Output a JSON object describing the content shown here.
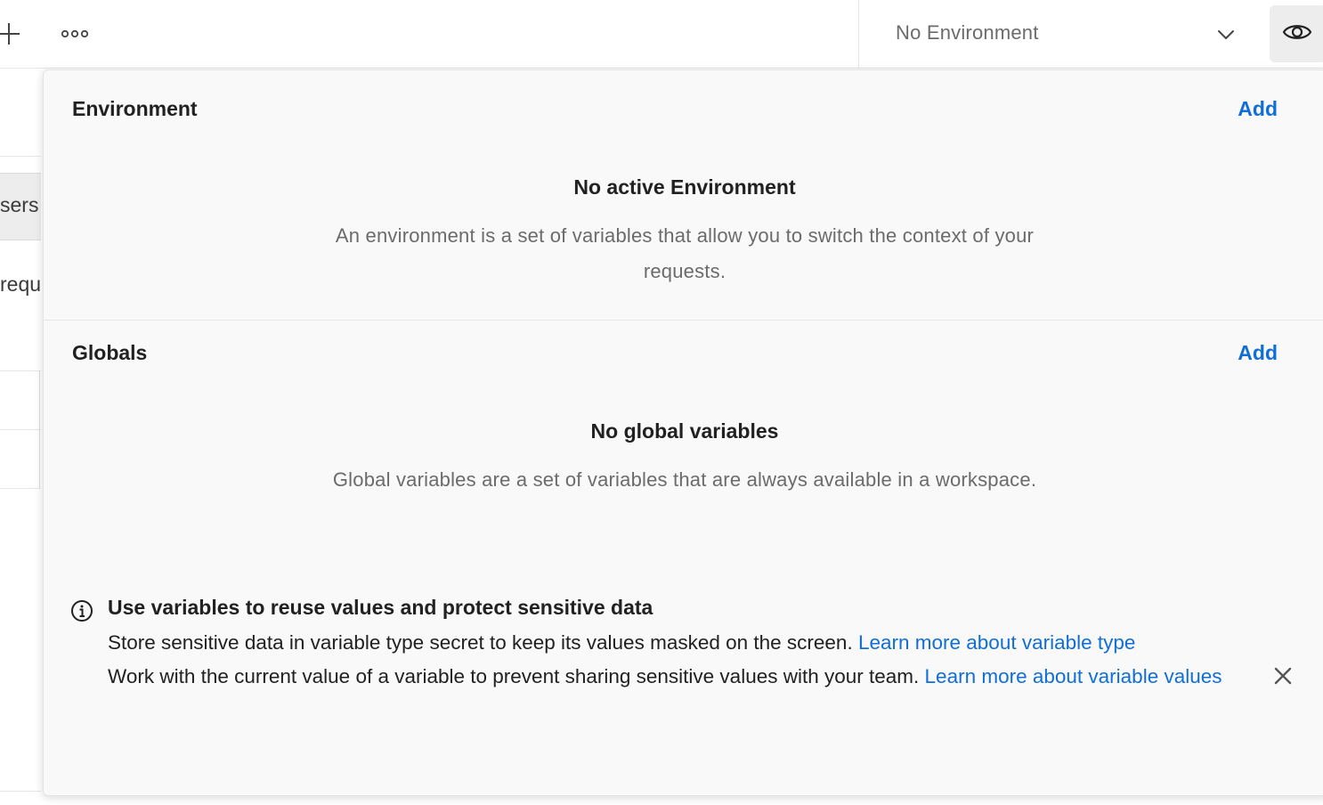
{
  "topbar": {
    "environment_select": {
      "value": "No Environment"
    }
  },
  "background": {
    "tab_fragment": "sers",
    "text_fragment": "requ"
  },
  "panel": {
    "environment": {
      "title": "Environment",
      "add_label": "Add",
      "empty_title": "No active Environment",
      "empty_description": "An environment is a set of variables that allow you to switch the context of your requests."
    },
    "globals": {
      "title": "Globals",
      "add_label": "Add",
      "empty_title": "No global variables",
      "empty_description": "Global variables are a set of variables that are always available in a workspace."
    },
    "info": {
      "title": "Use variables to reuse values and protect sensitive data",
      "line1_text": "Store sensitive data in variable type secret to keep its values masked on the screen.",
      "line1_link": "Learn more about variable type",
      "line2_text": "Work with the current value of a variable to prevent sharing sensitive values with your team.",
      "line2_link": "Learn more about variable values"
    }
  },
  "colors": {
    "link": "#0f6fd6",
    "muted_text": "#6b6b6b",
    "panel_background": "#f9f9f9"
  },
  "icons": [
    "plus-icon",
    "more-horizontal-icon",
    "chevron-down-icon",
    "eye-icon",
    "info-icon",
    "close-icon"
  ]
}
